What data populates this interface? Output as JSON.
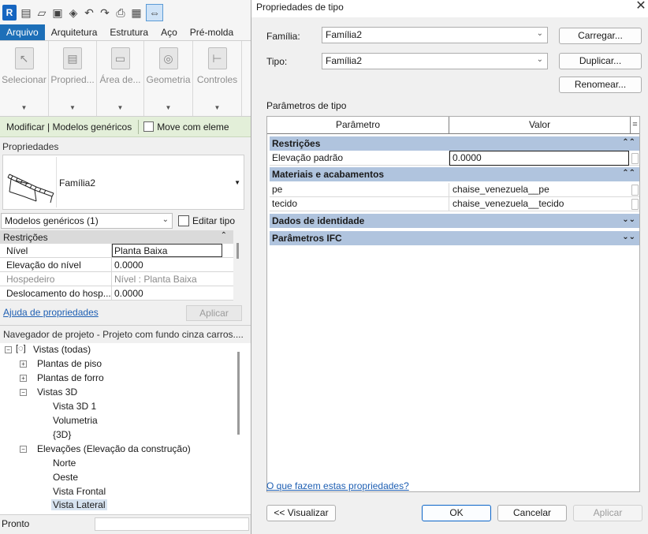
{
  "revit": {
    "logo": "R",
    "tabs": [
      "Arquivo",
      "Arquitetura",
      "Estrutura",
      "Aço",
      "Pré-molda"
    ],
    "ribbon_panels": [
      "Selecionar",
      "Propried...",
      "Área de...",
      "Geometria",
      "Controles"
    ],
    "context_label": "Modificar | Modelos genéricos",
    "move_with_label": "Move com eleme",
    "properties": {
      "title": "Propriedades",
      "type_name": "Família2",
      "category_selector": "Modelos genéricos (1)",
      "edit_type_label": "Editar tipo",
      "section": "Restrições",
      "rows": [
        {
          "name": "Nível",
          "value": "Planta Baixa"
        },
        {
          "name": "Elevação do nível",
          "value": "0.0000"
        },
        {
          "name": "Hospedeiro",
          "value": "Nível : Planta Baixa"
        },
        {
          "name": "Deslocamento do hosp...",
          "value": "0.0000"
        }
      ],
      "help_link": "Ajuda de propriedades",
      "apply_label": "Aplicar"
    },
    "navigator": {
      "title": "Navegador de projeto - Projeto com fundo cinza carros....",
      "items": [
        {
          "label": "Vistas (todas)"
        },
        {
          "label": "Plantas de piso"
        },
        {
          "label": "Plantas de forro"
        },
        {
          "label": "Vistas 3D"
        },
        {
          "label": "Vista 3D 1"
        },
        {
          "label": "Volumetria"
        },
        {
          "label": "{3D}"
        },
        {
          "label": "Elevações (Elevação da construção)"
        },
        {
          "label": "Norte"
        },
        {
          "label": "Oeste"
        },
        {
          "label": "Vista Frontal"
        },
        {
          "label": "Vista Lateral"
        }
      ]
    },
    "status": "Pronto"
  },
  "dialog": {
    "title": "Propriedades de tipo",
    "family_label": "Família:",
    "family_value": "Família2",
    "type_label": "Tipo:",
    "type_value": "Família2",
    "load_button": "Carregar...",
    "duplicate_button": "Duplicar...",
    "rename_button": "Renomear...",
    "group_caption": "Parâmetros de tipo",
    "col_param": "Parâmetro",
    "col_value": "Valor",
    "col_sign": "=",
    "sections": {
      "restrictions": {
        "title": "Restrições",
        "rows": [
          {
            "name": "Elevação padrão",
            "value": "0.0000"
          }
        ]
      },
      "materials": {
        "title": "Materiais e acabamentos",
        "rows": [
          {
            "name": "pe",
            "value": "chaise_venezuela__pe"
          },
          {
            "name": "tecido",
            "value": "chaise_venezuela__tecido"
          }
        ]
      },
      "identity": {
        "title": "Dados de identidade"
      },
      "ifc": {
        "title": "Parâmetros IFC"
      }
    },
    "help_link": "O que fazem estas propriedades?",
    "preview_button": "<< Visualizar",
    "ok_button": "OK",
    "cancel_button": "Cancelar",
    "apply_button": "Aplicar"
  }
}
